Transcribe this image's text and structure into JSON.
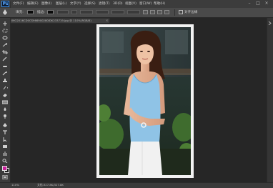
{
  "app": {
    "logo": "Ps",
    "menu": [
      "文件(F)",
      "编辑(E)",
      "图像(I)",
      "图层(L)",
      "文字(Y)",
      "选择(S)",
      "滤镜(T)",
      "3D(D)",
      "视图(V)",
      "窗口(W)",
      "帮助(H)"
    ],
    "window_controls": [
      "–",
      "□",
      "×"
    ]
  },
  "options_bar": {
    "label_fill": "填充:",
    "label_stroke": "描边:",
    "right_label": "对齐边缘"
  },
  "document": {
    "tab_title": "IMG2016CD0CS966900280IDK233719.jpg @ 110%(RGB/8)",
    "close": "×"
  },
  "status": {
    "zoom": "110%",
    "doc_size": "文档:327.8K/327.8K"
  },
  "colors": {
    "foreground": "#c8219a",
    "background": "#1a1a1a"
  }
}
